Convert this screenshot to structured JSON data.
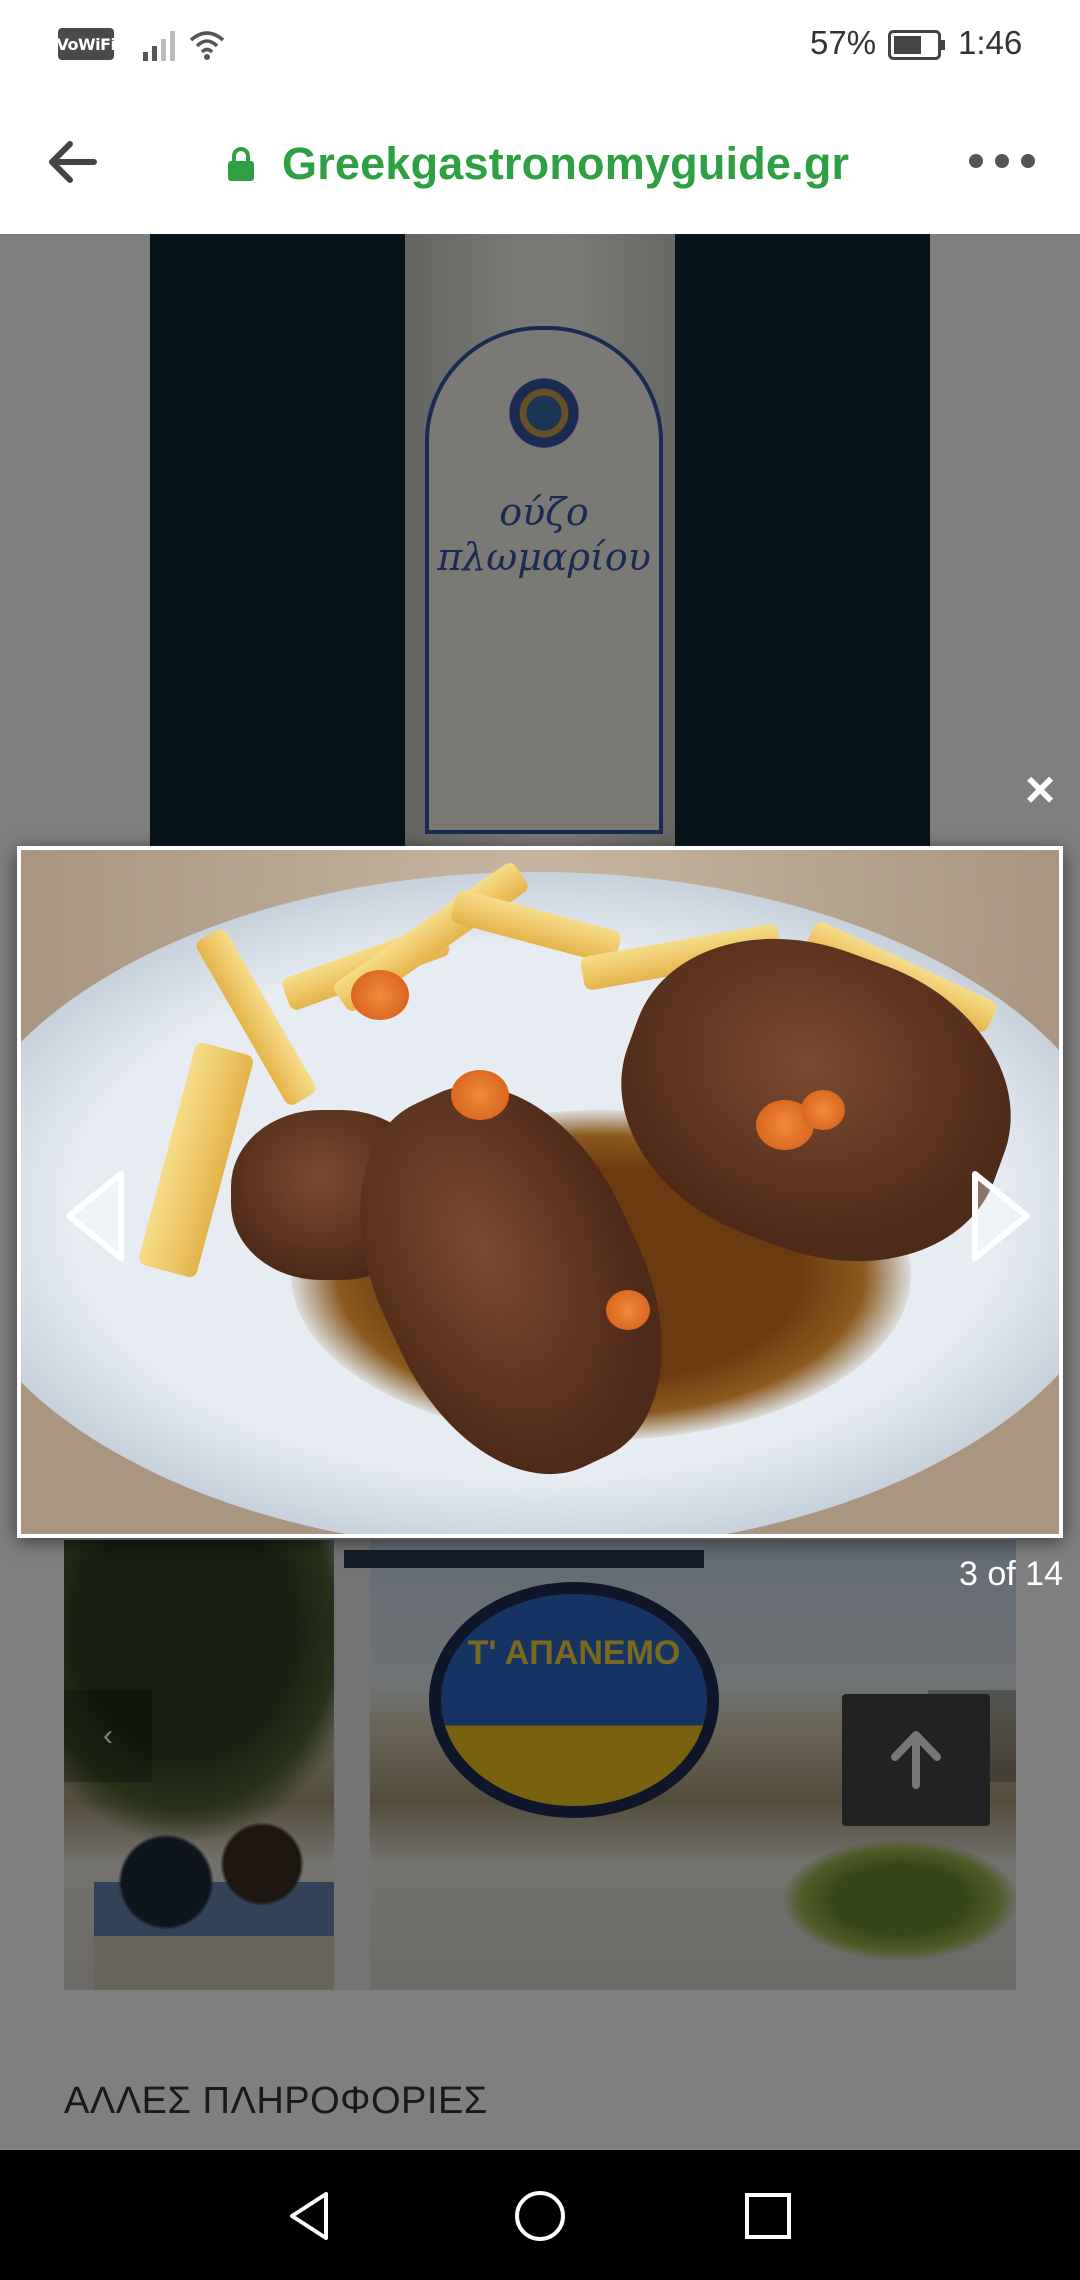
{
  "status_bar": {
    "vowifi": "VoWiFi",
    "battery_percent": "57%",
    "time": "1:46"
  },
  "browser": {
    "url": "Greekgastronomyguide.gr",
    "accent_color": "#2ea043",
    "icons": [
      "back-arrow-icon",
      "lock-icon",
      "more-options-icon"
    ]
  },
  "page": {
    "bottle_label": {
      "line1": "ούζο",
      "line2": "πλωμαρίου"
    },
    "restaurant_sign": {
      "title": "Τ' ΑΠΑΝΕΜΟ"
    },
    "section_heading": "ΑΛΛΕΣ ΠΛΗΡΟΦΟΡΙΕΣ",
    "carousel_prev_glyph": "‹",
    "carousel_next_glyph": "›"
  },
  "lightbox": {
    "close_glyph": "×",
    "counter": "3 of 14",
    "current_index": 3,
    "total": 14
  },
  "nav_bar": {
    "icons": [
      "nav-back-icon",
      "nav-home-icon",
      "nav-recents-icon"
    ]
  }
}
